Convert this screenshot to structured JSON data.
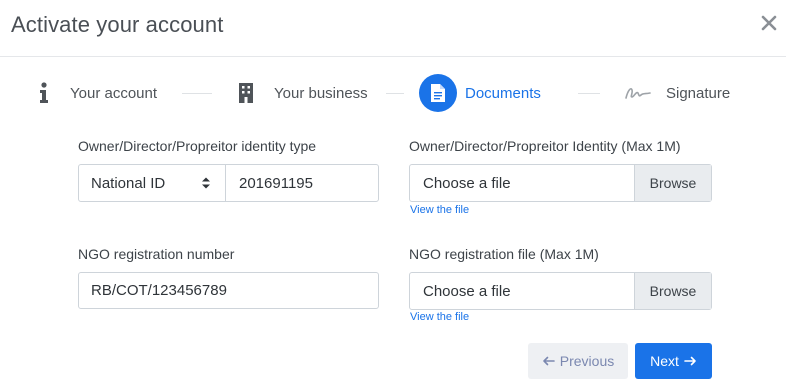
{
  "dialog": {
    "title": "Activate your account"
  },
  "steps": [
    {
      "label": "Your account",
      "icon": "info-icon",
      "state": "complete"
    },
    {
      "label": "Your business",
      "icon": "building-icon",
      "state": "complete"
    },
    {
      "label": "Documents",
      "icon": "document-icon",
      "state": "active"
    },
    {
      "label": "Signature",
      "icon": "signature-icon",
      "state": "pending"
    }
  ],
  "form": {
    "identity_type_label": "Owner/Director/Propreitor identity type",
    "identity_type_value": "National ID",
    "identity_number_value": "201691195",
    "identity_file_label": "Owner/Director/Propreitor Identity (Max 1M)",
    "identity_file_placeholder": "Choose a file",
    "identity_file_browse": "Browse",
    "identity_file_view": "View the file",
    "ngo_number_label": "NGO registration number",
    "ngo_number_value": "RB/COT/123456789",
    "ngo_file_label": "NGO registration file (Max 1M)",
    "ngo_file_placeholder": "Choose a file",
    "ngo_file_browse": "Browse",
    "ngo_file_view": "View the file"
  },
  "footer": {
    "previous_label": "Previous",
    "next_label": "Next"
  },
  "colors": {
    "accent": "#1a73e8",
    "step_text": "#4f5459",
    "prev_text": "#7b88b0"
  }
}
